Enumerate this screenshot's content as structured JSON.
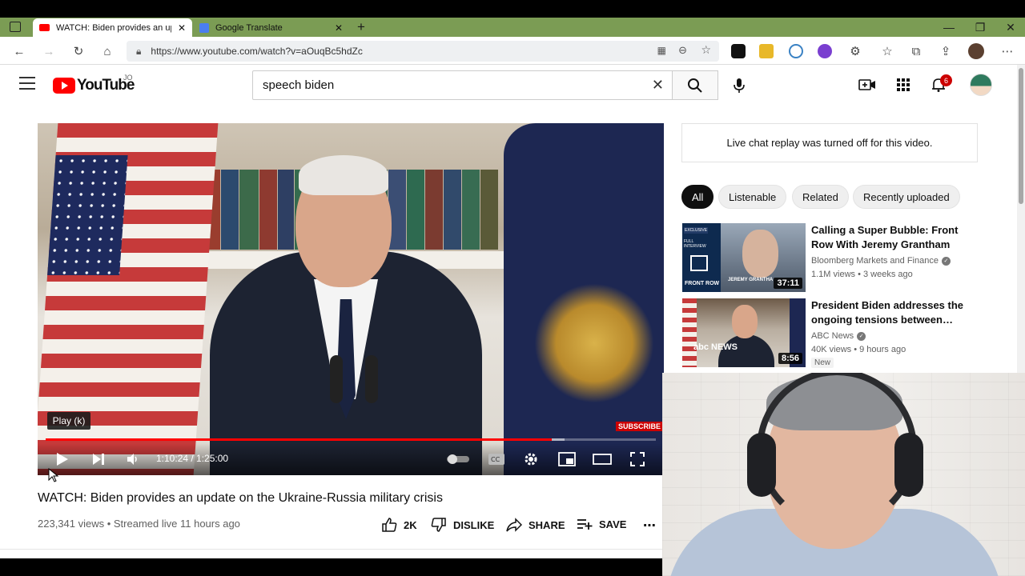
{
  "browser": {
    "tabs": [
      {
        "title": "WATCH: Biden provides an upda",
        "active": true
      },
      {
        "title": "Google Translate",
        "active": false
      }
    ],
    "url": "https://www.youtube.com/watch?v=aOuqBc5hdZc"
  },
  "youtube": {
    "logo_text": "YouTube",
    "country_code": "JO",
    "search_value": "speech biden",
    "notification_count": "6"
  },
  "player": {
    "tooltip": "Play (k)",
    "time": "1:10:24 / 1:25:00",
    "subscribe_watermark": "SUBSCRIBE",
    "progress_played": 0.83,
    "progress_buffered": 0.85
  },
  "video": {
    "title": "WATCH: Biden provides an update on the Ukraine-Russia military crisis",
    "meta": "223,341 views • Streamed live 11 hours ago",
    "like_count": "2K",
    "dislike_label": "DISLIKE",
    "share_label": "SHARE",
    "save_label": "SAVE"
  },
  "sidebar": {
    "chat_notice": "Live chat replay was turned off for this video.",
    "chips": [
      "All",
      "Listenable",
      "Related",
      "Recently uploaded"
    ],
    "recommendations": [
      {
        "title": "Calling a Super Bubble: Front Row With Jeremy Grantham",
        "channel": "Bloomberg Markets and Finance",
        "views": "1.1M views • 3 weeks ago",
        "duration": "37:11",
        "thumb_top": "EXCLUSIVE",
        "thumb_sub": "FULL INTERVIEW",
        "thumb_name": "JEREMY GRANTHA",
        "thumb_brand": "FRONT ROW"
      },
      {
        "title": "President Biden addresses the ongoing tensions between…",
        "channel": "ABC News",
        "views": "40K views • 9 hours ago",
        "duration": "8:56",
        "badge": "New",
        "thumb_brand": "abc NEWS"
      }
    ]
  },
  "colors": {
    "tabbar": "#7b9c54",
    "youtube_red": "#ff0000",
    "accent_dark": "#0f0f0f"
  }
}
